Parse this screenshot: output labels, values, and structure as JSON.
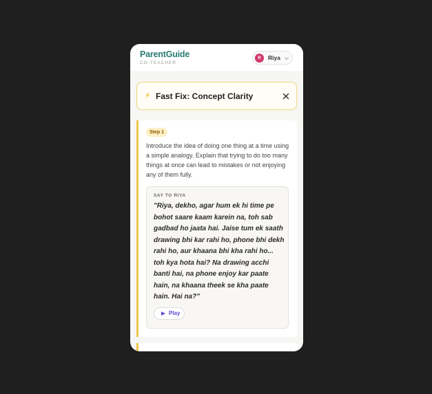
{
  "app": {
    "brand": "ParentGuide",
    "brand_sub": "CO-TEACHER"
  },
  "profile": {
    "initial": "R",
    "name": "Riya",
    "avatar_color": "#d23a6e"
  },
  "fast_fix": {
    "icon": "lightning-icon",
    "title": "Fast Fix: Concept Clarity",
    "close_icon": "close-icon"
  },
  "step": {
    "badge": "Step 1",
    "description": "Introduce the idea of doing one thing at a time using a simple analogy. Explain that trying to do too many things at once can lead to mistakes or not enjoying any of them fully.",
    "say_label": "SAY TO RIYA",
    "quote": "\"Riya, dekho, agar hum ek hi time pe bohot saare kaam karein na, toh sab gadbad ho jaata hai. Jaise tum ek saath drawing bhi kar rahi ho, phone bhi dekh rahi ho, aur khaana bhi kha rahi ho... toh kya hota hai? Na drawing acchi banti hai, na phone enjoy kar paate hain, na khaana theek se kha paate hain. Hai na?\"",
    "play_label": "Play"
  },
  "colors": {
    "brand": "#2a7a73",
    "accent": "#f0c64a",
    "play": "#5b4bd1"
  }
}
